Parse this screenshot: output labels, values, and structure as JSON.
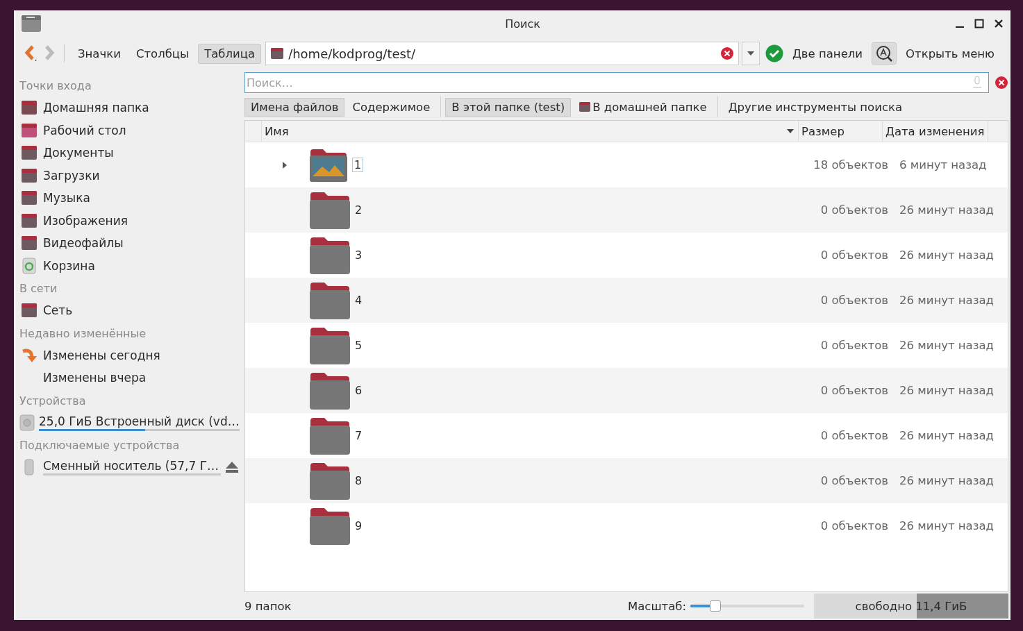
{
  "window": {
    "title": "Поиск"
  },
  "toolbar": {
    "views": [
      {
        "label": "Значки",
        "selected": false
      },
      {
        "label": "Столбцы",
        "selected": false
      },
      {
        "label": "Таблица",
        "selected": true
      }
    ],
    "path": "/home/kodprog/test/",
    "two_panes": "Две панели",
    "open_menu": "Открыть меню"
  },
  "sidebar": {
    "sections": [
      {
        "title": "Точки входа",
        "items": [
          {
            "label": "Домашняя папка",
            "kind": "home"
          },
          {
            "label": "Рабочий стол",
            "kind": "desktop"
          },
          {
            "label": "Документы",
            "kind": "docs"
          },
          {
            "label": "Загрузки",
            "kind": "folder"
          },
          {
            "label": "Музыка",
            "kind": "music"
          },
          {
            "label": "Изображения",
            "kind": "pictures"
          },
          {
            "label": "Видеофайлы",
            "kind": "video"
          },
          {
            "label": "Корзина",
            "kind": "trash"
          }
        ]
      },
      {
        "title": "В сети",
        "items": [
          {
            "label": "Сеть",
            "kind": "folder"
          }
        ]
      },
      {
        "title": "Недавно изменённые",
        "items": [
          {
            "label": "Изменены сегодня",
            "kind": "recent"
          },
          {
            "label": "Изменены вчера",
            "kind": "none"
          }
        ]
      },
      {
        "title": "Устройства",
        "items": [
          {
            "label": "25,0 ГиБ Встроенный диск (vd…",
            "kind": "disk",
            "level": 0.53
          }
        ]
      },
      {
        "title": "Подключаемые устройства",
        "items": [
          {
            "label": "Сменный носитель (57,7 Г…",
            "kind": "usb",
            "level": 0
          }
        ]
      }
    ]
  },
  "search": {
    "placeholder": "Поиск…",
    "scopes": [
      {
        "label": "Имена файлов",
        "selected": true
      },
      {
        "label": "Содержимое",
        "selected": false
      }
    ],
    "places": [
      {
        "label": "В этой папке (test)",
        "selected": true
      },
      {
        "label": "В домашней папке",
        "selected": false
      }
    ],
    "more": "Другие инструменты поиска"
  },
  "table": {
    "columns": [
      "Имя",
      "Размер",
      "Дата изменения"
    ],
    "rows": [
      {
        "name": "1",
        "size": "18 объектов",
        "modified": "6 минут назад",
        "kind": "preview",
        "expandable": true,
        "selected": true
      },
      {
        "name": "2",
        "size": "0 объектов",
        "modified": "26 минут назад",
        "kind": "folder",
        "expandable": false,
        "selected": false
      },
      {
        "name": "3",
        "size": "0 объектов",
        "modified": "26 минут назад",
        "kind": "folder",
        "expandable": false,
        "selected": false
      },
      {
        "name": "4",
        "size": "0 объектов",
        "modified": "26 минут назад",
        "kind": "folder",
        "expandable": false,
        "selected": false
      },
      {
        "name": "5",
        "size": "0 объектов",
        "modified": "26 минут назад",
        "kind": "folder",
        "expandable": false,
        "selected": false
      },
      {
        "name": "6",
        "size": "0 объектов",
        "modified": "26 минут назад",
        "kind": "folder",
        "expandable": false,
        "selected": false
      },
      {
        "name": "7",
        "size": "0 объектов",
        "modified": "26 минут назад",
        "kind": "folder",
        "expandable": false,
        "selected": false
      },
      {
        "name": "8",
        "size": "0 объектов",
        "modified": "26 минут назад",
        "kind": "folder",
        "expandable": false,
        "selected": false
      },
      {
        "name": "9",
        "size": "0 объектов",
        "modified": "26 минут назад",
        "kind": "folder",
        "expandable": false,
        "selected": false
      }
    ]
  },
  "status_bar": {
    "count": "9 папок",
    "zoom_label": "Масштаб:",
    "zoom": {
      "level": 0.22
    },
    "free": {
      "text": "свободно 11,4 ГиБ",
      "level": 0.53
    }
  }
}
